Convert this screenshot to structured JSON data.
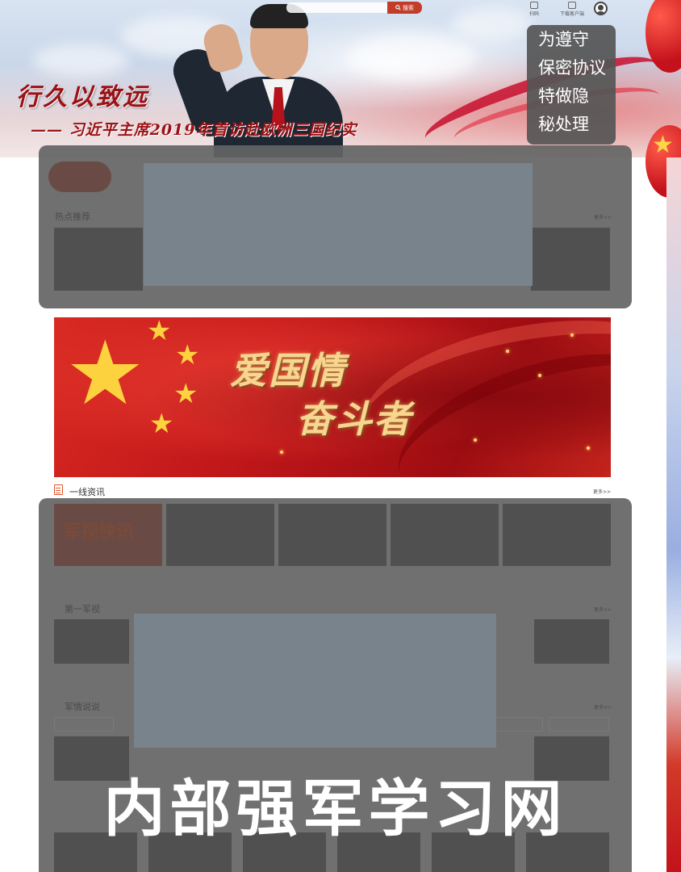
{
  "header": {
    "title": "行久以致远",
    "subtitle": "—— 习近平主席2019年首访赴欧洲三国纪实",
    "search_button": "搜索",
    "top_icons": [
      {
        "name": "scan-icon",
        "label": "扫码"
      },
      {
        "name": "desktop-icon",
        "label": "下载客户端"
      }
    ]
  },
  "notice": {
    "lines": [
      "为遵守",
      "保密协议",
      "特做隐",
      "秘处理"
    ]
  },
  "hot": {
    "title": "热点推荐",
    "more": "更多>>"
  },
  "promo": {
    "line1": "爱国情",
    "line2": "奋斗者"
  },
  "frontline": {
    "title": "一线资讯",
    "more": "更多>>",
    "thumb_caption": "军视快讯"
  },
  "military_video": {
    "title": "第一军视",
    "more": "更多>>"
  },
  "military_info": {
    "title": "军情说说",
    "more": "更多>>"
  },
  "watermark": "内部强军学习网",
  "colors": {
    "primary_red": "#c0171a",
    "gold": "#fcd23e",
    "overlay_gray": "#646464",
    "redact_gray": "#78838c"
  }
}
